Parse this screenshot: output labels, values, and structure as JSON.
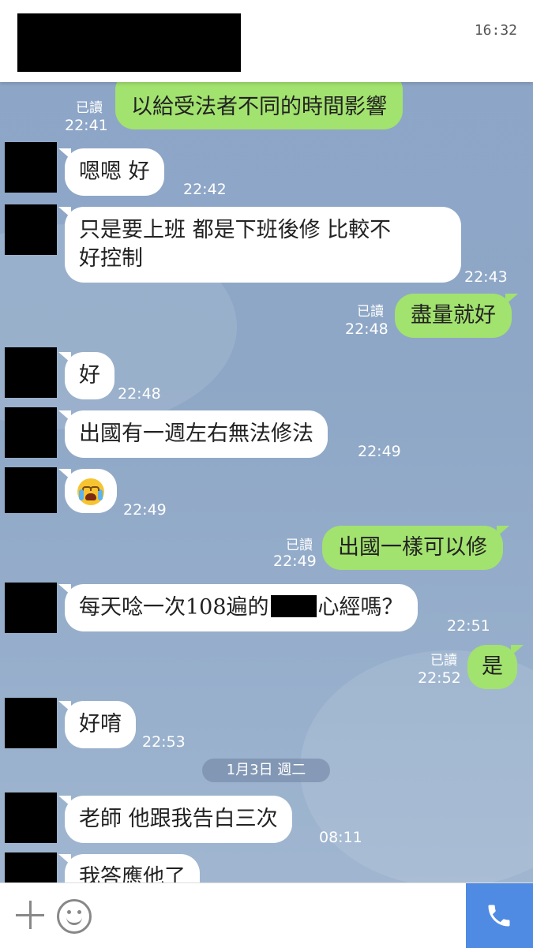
{
  "header": {
    "clock": "16:32"
  },
  "messages": [
    {
      "side": "out",
      "text": "以給受法者不同的時間影響",
      "read": "已讀",
      "time": "22:41"
    },
    {
      "side": "in",
      "text": "嗯嗯 好",
      "time": "22:42"
    },
    {
      "side": "in",
      "line1": "只是要上班 都是下班後修 比較不",
      "line2": "好控制",
      "time": "22:43"
    },
    {
      "side": "out",
      "text": "盡量就好",
      "read": "已讀",
      "time": "22:48"
    },
    {
      "side": "in",
      "text": "好",
      "time": "22:48"
    },
    {
      "side": "in",
      "text": "出國有一週左右無法修法",
      "time": "22:49"
    },
    {
      "side": "in",
      "emoji": "loudly-crying-face",
      "time": "22:49"
    },
    {
      "side": "out",
      "text": "出國一樣可以修",
      "read": "已讀",
      "time": "22:49"
    },
    {
      "side": "in",
      "text_a": "每天唸一次108遍的",
      "text_b": "心經嗎？",
      "time": "22:51"
    },
    {
      "side": "out",
      "text": "是",
      "read": "已讀",
      "time": "22:52"
    },
    {
      "side": "in",
      "text": "好唷",
      "time": "22:53"
    },
    {
      "side": "in",
      "text": "老師 他跟我告白三次",
      "time": "08:11"
    },
    {
      "side": "in",
      "text": "我答應他了"
    }
  ],
  "date_separator": "1月3日 週二",
  "footer": {
    "plus_icon": "plus-icon",
    "emoji_icon": "smiley-icon",
    "call_icon": "phone-icon",
    "call_color": "#4f8be2"
  }
}
